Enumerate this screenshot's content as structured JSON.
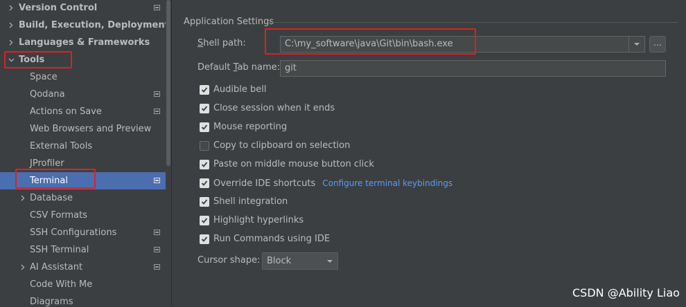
{
  "sidebar": {
    "items": [
      {
        "label": "Version Control",
        "bold": true,
        "expand": "collapsed",
        "indent": 0,
        "project_icon": true
      },
      {
        "label": "Build, Execution, Deployment",
        "bold": true,
        "expand": "collapsed",
        "indent": 0,
        "project_icon": false
      },
      {
        "label": "Languages & Frameworks",
        "bold": true,
        "expand": "collapsed",
        "indent": 0,
        "project_icon": false
      },
      {
        "label": "Tools",
        "bold": true,
        "expand": "expanded",
        "indent": 0,
        "project_icon": false
      },
      {
        "label": "Space",
        "bold": false,
        "expand": "none",
        "indent": 1,
        "project_icon": false
      },
      {
        "label": "Qodana",
        "bold": false,
        "expand": "none",
        "indent": 1,
        "project_icon": true
      },
      {
        "label": "Actions on Save",
        "bold": false,
        "expand": "none",
        "indent": 1,
        "project_icon": true
      },
      {
        "label": "Web Browsers and Preview",
        "bold": false,
        "expand": "none",
        "indent": 1,
        "project_icon": false
      },
      {
        "label": "External Tools",
        "bold": false,
        "expand": "none",
        "indent": 1,
        "project_icon": false
      },
      {
        "label": "JProfiler",
        "bold": false,
        "expand": "none",
        "indent": 1,
        "project_icon": false
      },
      {
        "label": "Terminal",
        "bold": false,
        "expand": "none",
        "indent": 1,
        "project_icon": true,
        "selected": true
      },
      {
        "label": "Database",
        "bold": false,
        "expand": "collapsed",
        "indent": 1,
        "project_icon": false
      },
      {
        "label": "CSV Formats",
        "bold": false,
        "expand": "none",
        "indent": 1,
        "project_icon": false
      },
      {
        "label": "SSH Configurations",
        "bold": false,
        "expand": "none",
        "indent": 1,
        "project_icon": true
      },
      {
        "label": "SSH Terminal",
        "bold": false,
        "expand": "none",
        "indent": 1,
        "project_icon": true
      },
      {
        "label": "AI Assistant",
        "bold": false,
        "expand": "collapsed",
        "indent": 1,
        "project_icon": true
      },
      {
        "label": "Code With Me",
        "bold": false,
        "expand": "none",
        "indent": 1,
        "project_icon": false
      },
      {
        "label": "Diagrams",
        "bold": false,
        "expand": "none",
        "indent": 1,
        "project_icon": false
      }
    ]
  },
  "settings": {
    "group_title": "Application Settings",
    "shell_path": {
      "mnemonic": "S",
      "rest": "hell path:",
      "value": "C:\\my_software\\java\\Git\\bin\\bash.exe",
      "browse": "..."
    },
    "tab_name": {
      "pre": "Default ",
      "mnemonic": "T",
      "post": "ab name:",
      "value": "git"
    },
    "checkboxes": [
      {
        "label": "Audible bell",
        "checked": true
      },
      {
        "label": "Close session when it ends",
        "checked": true
      },
      {
        "label": "Mouse reporting",
        "checked": true
      },
      {
        "label": "Copy to clipboard on selection",
        "checked": false
      },
      {
        "label": "Paste on middle mouse button click",
        "checked": true
      },
      {
        "label": "Override IDE shortcuts",
        "checked": true,
        "link": "Configure terminal keybindings"
      },
      {
        "label": "Shell integration",
        "checked": true
      },
      {
        "label": "Highlight hyperlinks",
        "checked": true
      },
      {
        "label": "Run Commands using IDE",
        "checked": true
      }
    ],
    "cursor_shape": {
      "label": "Cursor shape:",
      "value": "Block"
    }
  },
  "watermark": "CSDN @Ability Liao",
  "colors": {
    "accent": "#4b6eaf",
    "link": "#589df6",
    "highlight": "#e02020",
    "background": "#3c3f41"
  }
}
